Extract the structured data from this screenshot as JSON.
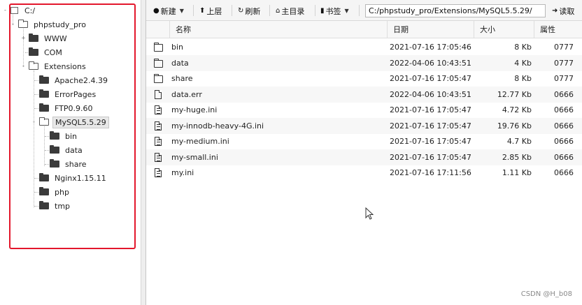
{
  "tree": {
    "nodes": [
      {
        "label": "C:/",
        "icon": "drive-icon",
        "expander": "-"
      },
      {
        "label": "phpstudy_pro",
        "icon": "folder-open-icon",
        "expander": "-"
      },
      {
        "label": "WWW",
        "icon": "folder-icon",
        "expander": "+"
      },
      {
        "label": "COM",
        "icon": "folder-icon",
        "expander": ""
      },
      {
        "label": "Extensions",
        "icon": "folder-open-icon",
        "expander": "-"
      },
      {
        "label": "Apache2.4.39",
        "icon": "folder-icon",
        "expander": ""
      },
      {
        "label": "ErrorPages",
        "icon": "folder-icon",
        "expander": ""
      },
      {
        "label": "FTP0.9.60",
        "icon": "folder-icon",
        "expander": ""
      },
      {
        "label": "MySQL5.5.29",
        "icon": "folder-open-icon",
        "expander": "-",
        "selected": true
      },
      {
        "label": "bin",
        "icon": "folder-icon",
        "expander": ""
      },
      {
        "label": "data",
        "icon": "folder-icon",
        "expander": ""
      },
      {
        "label": "share",
        "icon": "folder-icon",
        "expander": ""
      },
      {
        "label": "Nginx1.15.11",
        "icon": "folder-icon",
        "expander": ""
      },
      {
        "label": "php",
        "icon": "folder-icon",
        "expander": ""
      },
      {
        "label": "tmp",
        "icon": "folder-icon",
        "expander": ""
      }
    ],
    "highlight_color": "#e3172c"
  },
  "toolbar": {
    "new_label": "新建",
    "up_label": "上层",
    "refresh_label": "刷新",
    "home_label": "主目录",
    "bookmark_label": "书签",
    "path_value": "C:/phpstudy_pro/Extensions/MySQL5.5.29/",
    "read_label": "读取"
  },
  "columns": {
    "name": "名称",
    "date": "日期",
    "size": "大小",
    "attr": "属性"
  },
  "files": [
    {
      "name": "bin",
      "type": "folder",
      "date": "2021-07-16 17:05:46",
      "size": "8 Kb",
      "attr": "0777"
    },
    {
      "name": "data",
      "type": "folder",
      "date": "2022-04-06 10:43:51",
      "size": "4 Kb",
      "attr": "0777"
    },
    {
      "name": "share",
      "type": "folder",
      "date": "2021-07-16 17:05:47",
      "size": "8 Kb",
      "attr": "0777"
    },
    {
      "name": "data.err",
      "type": "file",
      "date": "2022-04-06 10:43:51",
      "size": "12.77 Kb",
      "attr": "0666"
    },
    {
      "name": "my-huge.ini",
      "type": "text",
      "date": "2021-07-16 17:05:47",
      "size": "4.72 Kb",
      "attr": "0666"
    },
    {
      "name": "my-innodb-heavy-4G.ini",
      "type": "text",
      "date": "2021-07-16 17:05:47",
      "size": "19.76 Kb",
      "attr": "0666"
    },
    {
      "name": "my-medium.ini",
      "type": "text",
      "date": "2021-07-16 17:05:47",
      "size": "4.7 Kb",
      "attr": "0666"
    },
    {
      "name": "my-small.ini",
      "type": "text",
      "date": "2021-07-16 17:05:47",
      "size": "2.85 Kb",
      "attr": "0666"
    },
    {
      "name": "my.ini",
      "type": "text",
      "date": "2021-07-16 17:11:56",
      "size": "1.11 Kb",
      "attr": "0666"
    }
  ],
  "watermark": "CSDN @H_b08"
}
